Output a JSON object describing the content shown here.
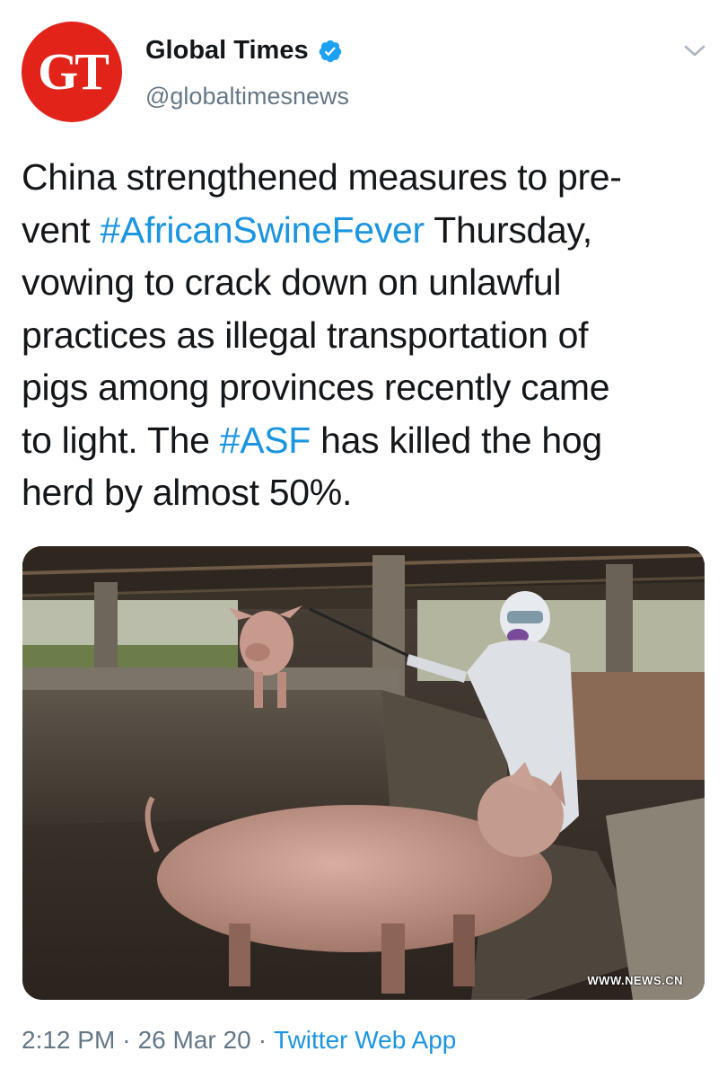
{
  "account": {
    "avatar_text": "GT",
    "display_name": "Global Times",
    "handle": "@globaltimesnews",
    "verified": true
  },
  "tweet": {
    "lines": [
      [
        {
          "t": "China strengthened measures to pre-",
          "tag": false
        }
      ],
      [
        {
          "t": "vent ",
          "tag": false
        },
        {
          "t": "#AfricanSwineFever",
          "tag": true
        },
        {
          "t": " Thursday,",
          "tag": false
        }
      ],
      [
        {
          "t": "vowing to crack down on unlawful",
          "tag": false
        }
      ],
      [
        {
          "t": "practices as illegal transportation of",
          "tag": false
        }
      ],
      [
        {
          "t": "pigs among provinces recently came",
          "tag": false
        }
      ],
      [
        {
          "t": "to light. The ",
          "tag": false
        },
        {
          "t": "#ASF",
          "tag": true
        },
        {
          "t": " has killed the hog",
          "tag": false
        }
      ],
      [
        {
          "t": "herd by almost 50%.",
          "tag": false
        }
      ]
    ]
  },
  "media": {
    "watermark": "WWW.NEWS.CN"
  },
  "meta": {
    "time": "2:12 PM",
    "separator": "·",
    "date": "26 Mar 20",
    "source": "Twitter Web App"
  },
  "colors": {
    "link": "#1b95e0",
    "secondary": "#657786",
    "avatar_bg": "#e2231a"
  },
  "icons": [
    "verified-badge-icon",
    "chevron-down-icon"
  ]
}
